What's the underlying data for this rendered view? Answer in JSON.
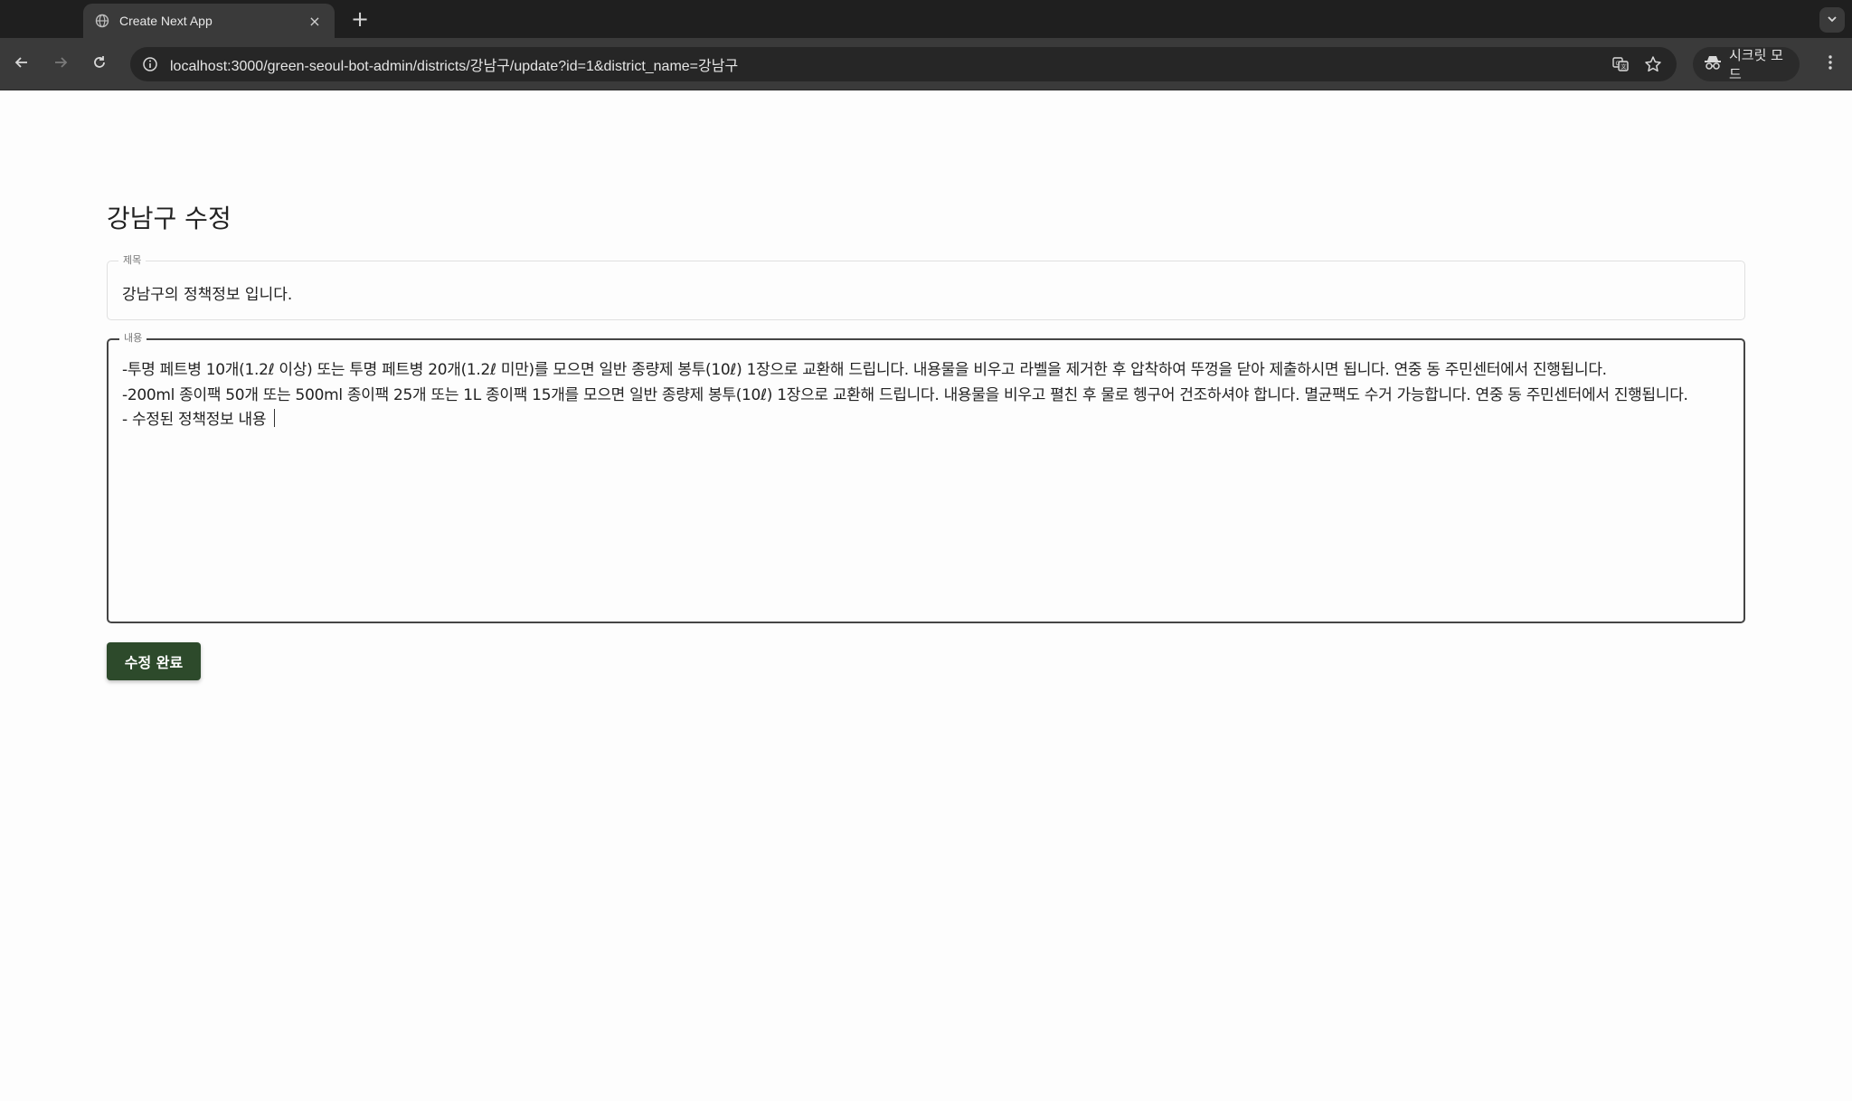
{
  "browser": {
    "tab": {
      "title": "Create Next App",
      "close": "×"
    },
    "new_tab": "+",
    "url": "localhost:3000/green-seoul-bot-admin/districts/강남구/update?id=1&district_name=강남구",
    "incognito_label": "시크릿 모드"
  },
  "page": {
    "title": "강남구 수정",
    "title_field": {
      "label": "제목",
      "value": "강남구의 정책정보 입니다."
    },
    "content_field": {
      "label": "내용",
      "value": "-투명 페트병 10개(1.2ℓ 이상) 또는 투명 페트병 20개(1.2ℓ 미만)를 모으면 일반 종량제 봉투(10ℓ) 1장으로 교환해 드립니다. 내용물을 비우고 라벨을 제거한 후 압착하여 뚜껑을 닫아 제출하시면 됩니다. 연중 동 주민센터에서 진행됩니다.\n-200ml 종이팩 50개 또는 500ml 종이팩 25개 또는 1L 종이팩 15개를 모으면 일반 종량제 봉투(10ℓ) 1장으로 교환해 드립니다. 내용물을 비우고 펼친 후 물로 헹구어 건조하셔야 합니다. 멸균팩도 수거 가능합니다. 연중 동 주민센터에서 진행됩니다.\n- 수정된 정책정보 내용 "
    },
    "submit_label": "수정 완료"
  },
  "colors": {
    "tabbar_bg": "#1f1f1f",
    "toolbar_bg": "#3a3a3a",
    "submit_bg": "#2d4a2b"
  }
}
